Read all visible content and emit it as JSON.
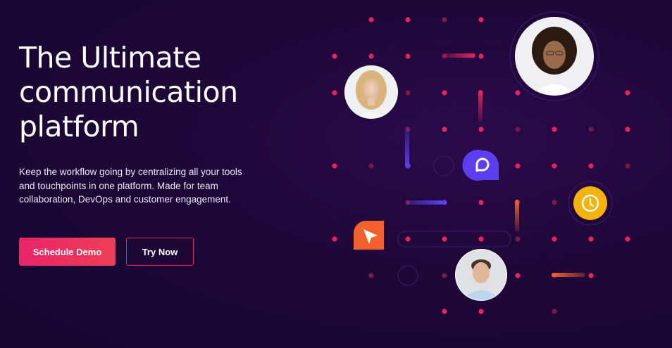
{
  "hero": {
    "title_lines": [
      "The Ultimate",
      "communication",
      "platform"
    ],
    "description": "Keep the workflow going by centralizing all your tools and touchpoints in one platform. Made for team collaboration, DevOps and customer engagement.",
    "primary_button": "Schedule Demo",
    "secondary_button": "Try Now"
  },
  "colors": {
    "background": "#1e0838",
    "accent_pink": "#e8245e",
    "accent_purple": "#5b3ef0",
    "accent_orange": "#f2612d",
    "accent_yellow": "#f5b20a"
  },
  "illustration": {
    "icons": [
      "chat-bubble-icon",
      "cursor-arrow-icon",
      "clock-icon"
    ],
    "avatars": [
      "avatar-woman-blonde",
      "avatar-woman-curly",
      "avatar-man"
    ]
  }
}
